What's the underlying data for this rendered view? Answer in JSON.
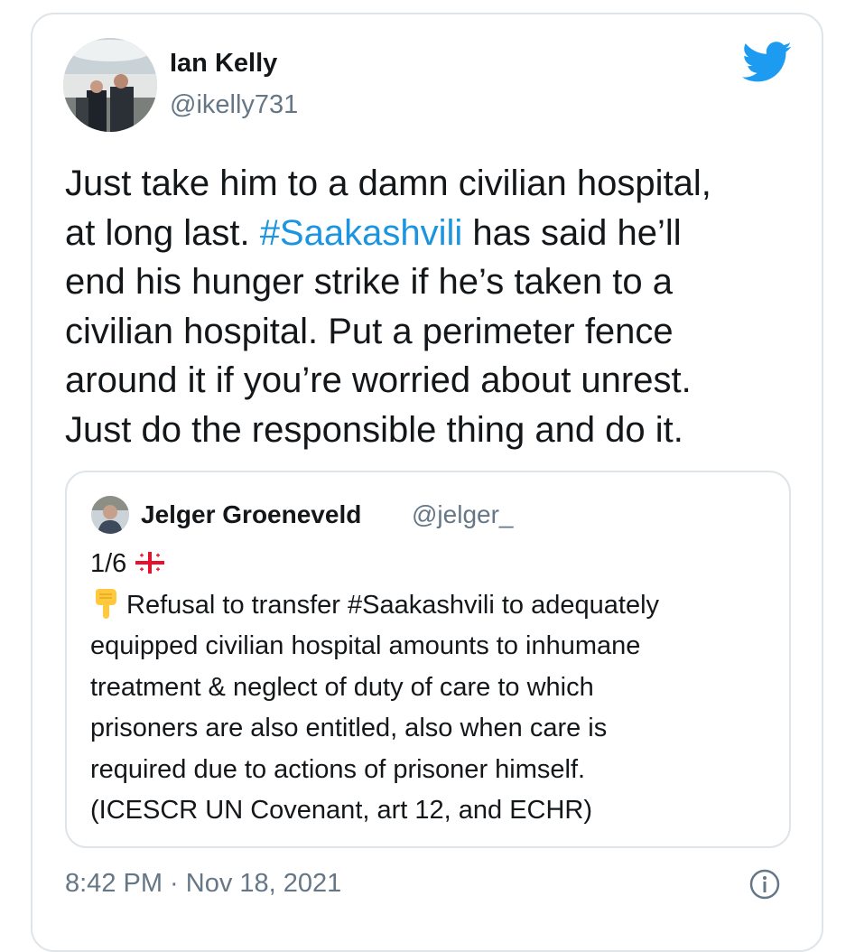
{
  "tweet": {
    "author_name": "Ian Kelly",
    "author_handle": "@ikelly731",
    "text_lines": [
      [
        "Just take him to a damn civilian hospital,"
      ],
      [
        "at long last. ",
        "#Saakashvili",
        " has said he’ll"
      ],
      [
        "end his hunger strike if he’s taken to a"
      ],
      [
        "civilian hospital. Put a perimeter fence"
      ],
      [
        "around it if you’re worried about unrest."
      ],
      [
        "Just do the responsible thing and do it."
      ]
    ],
    "timestamp": "8:42 PM · Nov 18, 2021"
  },
  "quoted_tweet": {
    "author_name": "Jelger Groeneveld",
    "author_handle": "@jelger_",
    "counter": "1/6",
    "flag_icon": "georgia-flag-icon",
    "pointing_icon": "pointing-down-emoji-icon",
    "text_lines": [
      "Refusal to transfer #Saakashvili to adequately",
      "equipped civilian hospital amounts to inhumane",
      "treatment & neglect of duty of care to which",
      "prisoners are also entitled, also when care is",
      "required due to actions of prisoner himself.",
      "(ICESCR UN Covenant, art 12, and ECHR)"
    ]
  },
  "icons": {
    "brand": "twitter-bird-icon",
    "info": "info-icon"
  },
  "colors": {
    "twitter_blue": "#1d9bf0",
    "hashtag": "#1b95e0",
    "secondary_text": "#657786",
    "border": "#dfe4e8"
  }
}
